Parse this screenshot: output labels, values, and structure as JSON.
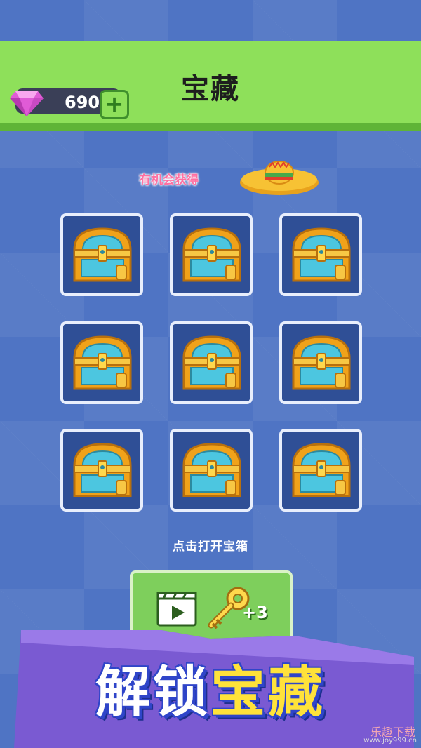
{
  "header": {
    "title": "宝藏",
    "gems": "690",
    "plus": "+"
  },
  "reward": {
    "chance_label": "有机会获得",
    "item_icon": "sombrero-hat-icon"
  },
  "chests": [
    {
      "icon": "treasure-chest-icon"
    },
    {
      "icon": "treasure-chest-icon"
    },
    {
      "icon": "treasure-chest-icon"
    },
    {
      "icon": "treasure-chest-icon"
    },
    {
      "icon": "treasure-chest-icon"
    },
    {
      "icon": "treasure-chest-icon"
    },
    {
      "icon": "treasure-chest-icon"
    },
    {
      "icon": "treasure-chest-icon"
    },
    {
      "icon": "treasure-chest-icon"
    }
  ],
  "hint": "点击打开宝箱",
  "video_button": {
    "icon": "video-clapper-icon",
    "key_icon": "key-icon",
    "reward": "+3"
  },
  "banner": {
    "text_white": "解锁",
    "text_yellow": "宝藏"
  },
  "watermark": {
    "brand": "乐趣下载",
    "url": "www.joy999.cn"
  },
  "colors": {
    "header_green": "#8ee05a",
    "background_blue": "#4f74c4",
    "slot_blue": "#2f4f96",
    "banner_purple": "#7a5ad2",
    "title_yellow": "#ffe23a"
  }
}
